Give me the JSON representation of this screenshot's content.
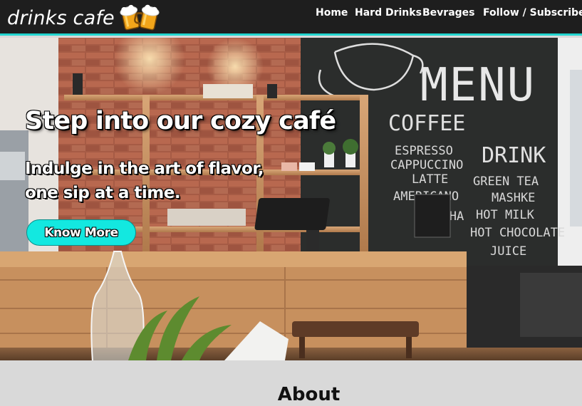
{
  "nav": {
    "brand": "drinks cafe",
    "brand_icon": "beer-mugs-icon",
    "links": [
      "Home",
      "Hard Drinks",
      "Bevrages",
      "Follow / Subscribe"
    ]
  },
  "hero": {
    "title": "Step into our cozy café",
    "subtitle": "Indulge in the art of flavor, one sip at a time.",
    "cta_label": "Know More",
    "board": {
      "heading": "MENU",
      "left_col_title": "COFFEE",
      "left_items": [
        "ESPRESSO",
        "CAPPUCCINO",
        "LATTE",
        "AMERICANO",
        "MOCHA"
      ],
      "right_col_title": "DRINK",
      "right_items": [
        "GREEN TEA",
        "MASHKE",
        "HOT MILK",
        "HOT CHOCOLATE",
        "JUICE"
      ]
    }
  },
  "about": {
    "heading": "About"
  },
  "colors": {
    "accent": "#13e8e0",
    "nav_bg": "#1e1e1e",
    "section_bg": "#d9d9d9"
  }
}
